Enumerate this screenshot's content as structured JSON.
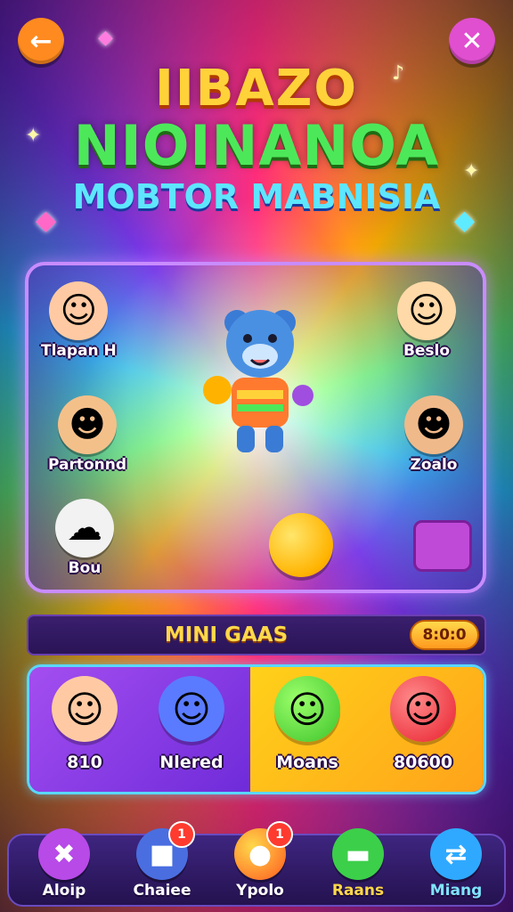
{
  "header": {
    "back_icon": "back-arrow-icon",
    "close_icon": "close-x-icon",
    "title_line1": "IIBAZO",
    "title_line2": "NIOINANOA",
    "title_line3": "MOBTOR MABNISIA"
  },
  "characters": [
    {
      "label": "Tlapan H"
    },
    {
      "label": "Beslo"
    },
    {
      "label": "Partonnd"
    },
    {
      "label": "Zoalo"
    },
    {
      "label": "Bou"
    }
  ],
  "mini_games": {
    "title": "MINI GAAS",
    "count": "8:0:0",
    "items": [
      {
        "label": "810"
      },
      {
        "label": "Nlered"
      },
      {
        "label": "Moans"
      },
      {
        "label": "80600"
      }
    ]
  },
  "nav": {
    "items": [
      {
        "label": "Aloip",
        "icon": "x-icon",
        "badge": ""
      },
      {
        "label": "Chaiee",
        "icon": "card-icon",
        "badge": "1"
      },
      {
        "label": "Ypolo",
        "icon": "ball-icon",
        "badge": "1"
      },
      {
        "label": "Raans",
        "icon": "chat-icon",
        "badge": ""
      },
      {
        "label": "Miang",
        "icon": "share-icon",
        "badge": ""
      }
    ]
  },
  "colors": {
    "accent_orange": "#ff8a1f",
    "accent_pink": "#e04fcf",
    "panel_border": "#c98cff",
    "games_border": "#5ad7ff"
  }
}
